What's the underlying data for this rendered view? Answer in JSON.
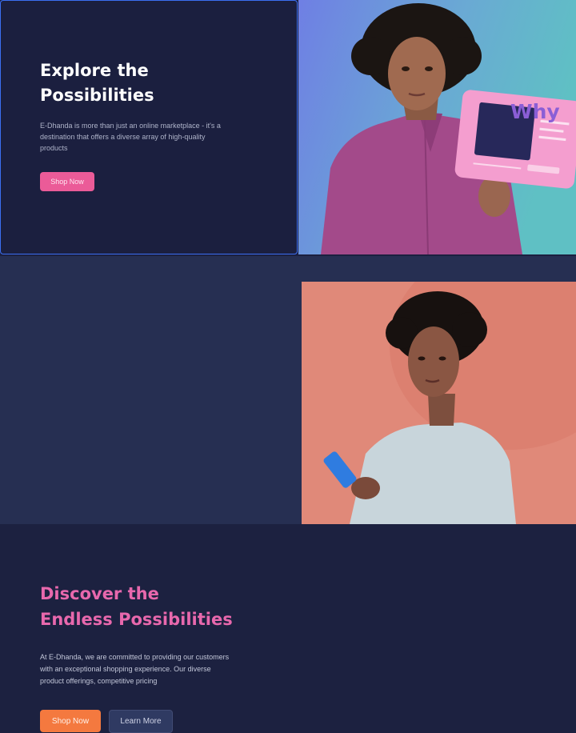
{
  "hero1": {
    "title_line1": "Explore the",
    "title_line2": "Possibilities",
    "description": "E-Dhanda is more than just an online marketplace - it's a destination that offers a diverse array of high-quality products",
    "shop_button": "Shop Now",
    "image_overlay_text": "Why"
  },
  "hero2": {
    "title_line1": "Discover the",
    "title_line2": "Endless Possibilities",
    "description": "At E-Dhanda, we are committed to providing our customers with an exceptional shopping experience. Our diverse product offerings, competitive pricing",
    "shop_button": "Shop Now",
    "learn_button": "Learn More"
  },
  "colors": {
    "hero1_bg": "#1b1f3f",
    "hero2_bg": "#262f52",
    "pink_accent": "#eb5b98",
    "orange_accent": "#f4793f",
    "hero2_title": "#e868ad"
  }
}
